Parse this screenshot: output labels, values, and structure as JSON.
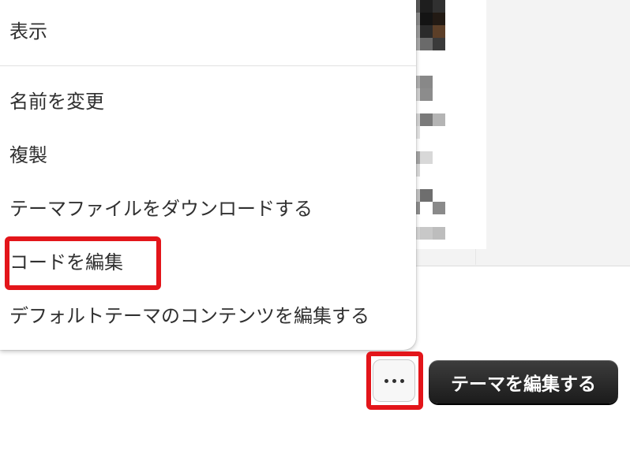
{
  "menu": {
    "items": [
      {
        "label": "表示"
      },
      {
        "label": "名前を変更"
      },
      {
        "label": "複製"
      },
      {
        "label": "テーマファイルをダウンロードする"
      },
      {
        "label": "コードを編集"
      },
      {
        "label": "デフォルトテーマのコンテンツを編集する"
      }
    ]
  },
  "actions": {
    "more_icon": "more-horizontal-icon",
    "edit_theme_label": "テーマを編集する"
  },
  "colors": {
    "highlight": "#e3151a",
    "primary_button": "#2a2a2a",
    "background": "#f3f3f3"
  }
}
